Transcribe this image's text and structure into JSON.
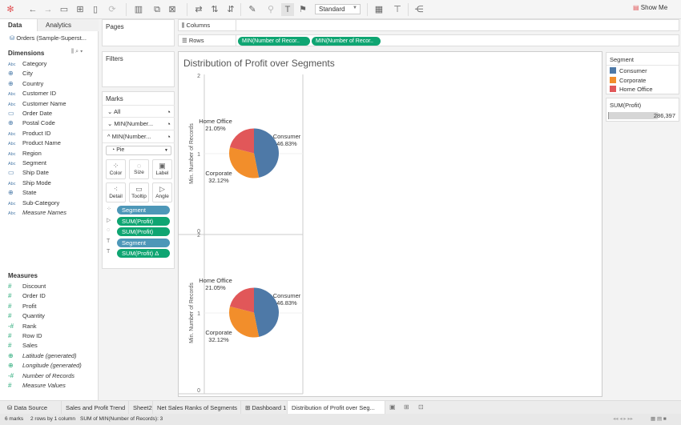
{
  "toolbar": {
    "view_size": "Standard",
    "show_me": "Show Me"
  },
  "datapane": {
    "tabs": [
      "Data",
      "Analytics"
    ],
    "datasource": "Orders (Sample-Superst...",
    "dimensions_header": "Dimensions",
    "dimensions": [
      {
        "type": "Abc",
        "label": "Category"
      },
      {
        "type": "globe",
        "label": "City"
      },
      {
        "type": "globe",
        "label": "Country"
      },
      {
        "type": "Abc",
        "label": "Customer ID"
      },
      {
        "type": "Abc",
        "label": "Customer Name"
      },
      {
        "type": "date",
        "label": "Order Date"
      },
      {
        "type": "globe",
        "label": "Postal Code"
      },
      {
        "type": "Abc",
        "label": "Product ID"
      },
      {
        "type": "Abc",
        "label": "Product Name"
      },
      {
        "type": "Abc",
        "label": "Region"
      },
      {
        "type": "Abc",
        "label": "Segment"
      },
      {
        "type": "date",
        "label": "Ship Date"
      },
      {
        "type": "Abc",
        "label": "Ship Mode"
      },
      {
        "type": "globe",
        "label": "State"
      },
      {
        "type": "Abc",
        "label": "Sub-Category"
      },
      {
        "type": "Abc",
        "label": "Measure Names",
        "italic": true
      }
    ],
    "measures_header": "Measures",
    "measures": [
      {
        "type": "#",
        "label": "Discount"
      },
      {
        "type": "#",
        "label": "Order ID"
      },
      {
        "type": "#",
        "label": "Profit"
      },
      {
        "type": "#",
        "label": "Quantity"
      },
      {
        "type": "-#",
        "label": "Rank"
      },
      {
        "type": "#",
        "label": "Row ID"
      },
      {
        "type": "#",
        "label": "Sales"
      },
      {
        "type": "globe",
        "label": "Latitude (generated)",
        "italic": true
      },
      {
        "type": "globe",
        "label": "Longitude (generated)",
        "italic": true
      },
      {
        "type": "-#",
        "label": "Number of Records",
        "italic": true
      },
      {
        "type": "#",
        "label": "Measure Values",
        "italic": true
      }
    ]
  },
  "shelves": {
    "pages": "Pages",
    "filters": "Filters",
    "columns": "Columns",
    "rows": "Rows",
    "row_pills": [
      "MIN(Number of Recor..",
      "MIN(Number of Recor.."
    ]
  },
  "marks": {
    "title": "Marks",
    "cards": [
      "All",
      "MIN(Number...",
      "MIN(Number..."
    ],
    "mark_type": "Pie",
    "buttons": [
      "Color",
      "Size",
      "Label",
      "Detail",
      "Tooltip",
      "Angle"
    ],
    "pills": [
      {
        "icon": "color",
        "label": "Segment",
        "kind": "d"
      },
      {
        "icon": "angle",
        "label": "SUM(Profit)",
        "kind": "m"
      },
      {
        "icon": "size",
        "label": "SUM(Profit)",
        "kind": "m"
      },
      {
        "icon": "label",
        "label": "Segment",
        "kind": "d"
      },
      {
        "icon": "label",
        "label": "SUM(Profit) Δ",
        "kind": "m"
      }
    ]
  },
  "view": {
    "title": "Distribution of Profit over Segments",
    "axis_label": "Min. Number of Records",
    "axis_ticks": [
      "2",
      "1",
      "0"
    ]
  },
  "chart_data": {
    "type": "pie",
    "panes": 2,
    "slices": [
      {
        "name": "Consumer",
        "value": 46.83,
        "label": "46.83%",
        "color": "#4e79a7"
      },
      {
        "name": "Corporate",
        "value": 32.12,
        "label": "32.12%",
        "color": "#f28e2b"
      },
      {
        "name": "Home Office",
        "value": 21.05,
        "label": "21.05%",
        "color": "#e15759"
      }
    ]
  },
  "legend": {
    "title": "Segment",
    "items": [
      {
        "label": "Consumer",
        "color": "#4e79a7"
      },
      {
        "label": "Corporate",
        "color": "#f28e2b"
      },
      {
        "label": "Home Office",
        "color": "#e15759"
      }
    ],
    "size_title": "SUM(Profit)",
    "size_value": "286,397"
  },
  "tabs": [
    "Data Source",
    "Sales and Profit Trend",
    "Sheet2",
    "Net Sales Ranks of Segments",
    "Dashboard 1",
    "Distribution of Profit over Seg..."
  ],
  "status": {
    "marks": "6 marks",
    "grid": "2 rows by 1 column",
    "sum": "SUM of MIN(Number of Records): 3"
  }
}
